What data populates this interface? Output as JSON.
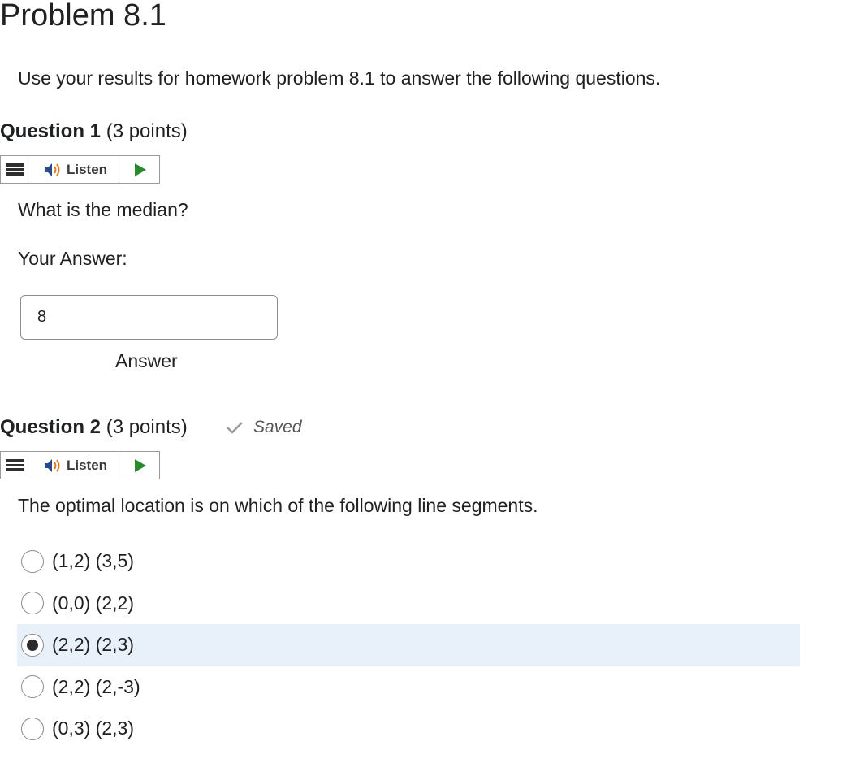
{
  "page": {
    "title": "Problem 8.1",
    "intro": "Use your results for homework problem 8.1 to answer the following questions."
  },
  "question1": {
    "label": "Question 1",
    "points": "(3 points)",
    "listen_label": "Listen",
    "prompt": "What is the median?",
    "answer_label": "Your Answer:",
    "answer_value": "8",
    "answer_caption": "Answer"
  },
  "question2": {
    "label": "Question 2",
    "points": "(3 points)",
    "status": "Saved",
    "listen_label": "Listen",
    "prompt": "The optimal location is on which of the following line segments.",
    "selected_index": 2,
    "options": [
      {
        "label": "(1,2) (3,5)"
      },
      {
        "label": "(0,0) (2,2)"
      },
      {
        "label": "(2,2) (2,3)"
      },
      {
        "label": "(2,2) (2,-3)"
      },
      {
        "label": "(0,3) (2,3)"
      }
    ]
  },
  "colors": {
    "selected_row_bg": "#e8f0f9",
    "play_green": "#2a8a2a",
    "speaker_blue": "#2b4a8b",
    "speaker_orange": "#e07a1f"
  },
  "icons": {
    "menu": "menu-icon",
    "speaker": "speaker-icon",
    "play": "play-icon",
    "check": "check-icon",
    "radio": "radio-button"
  }
}
